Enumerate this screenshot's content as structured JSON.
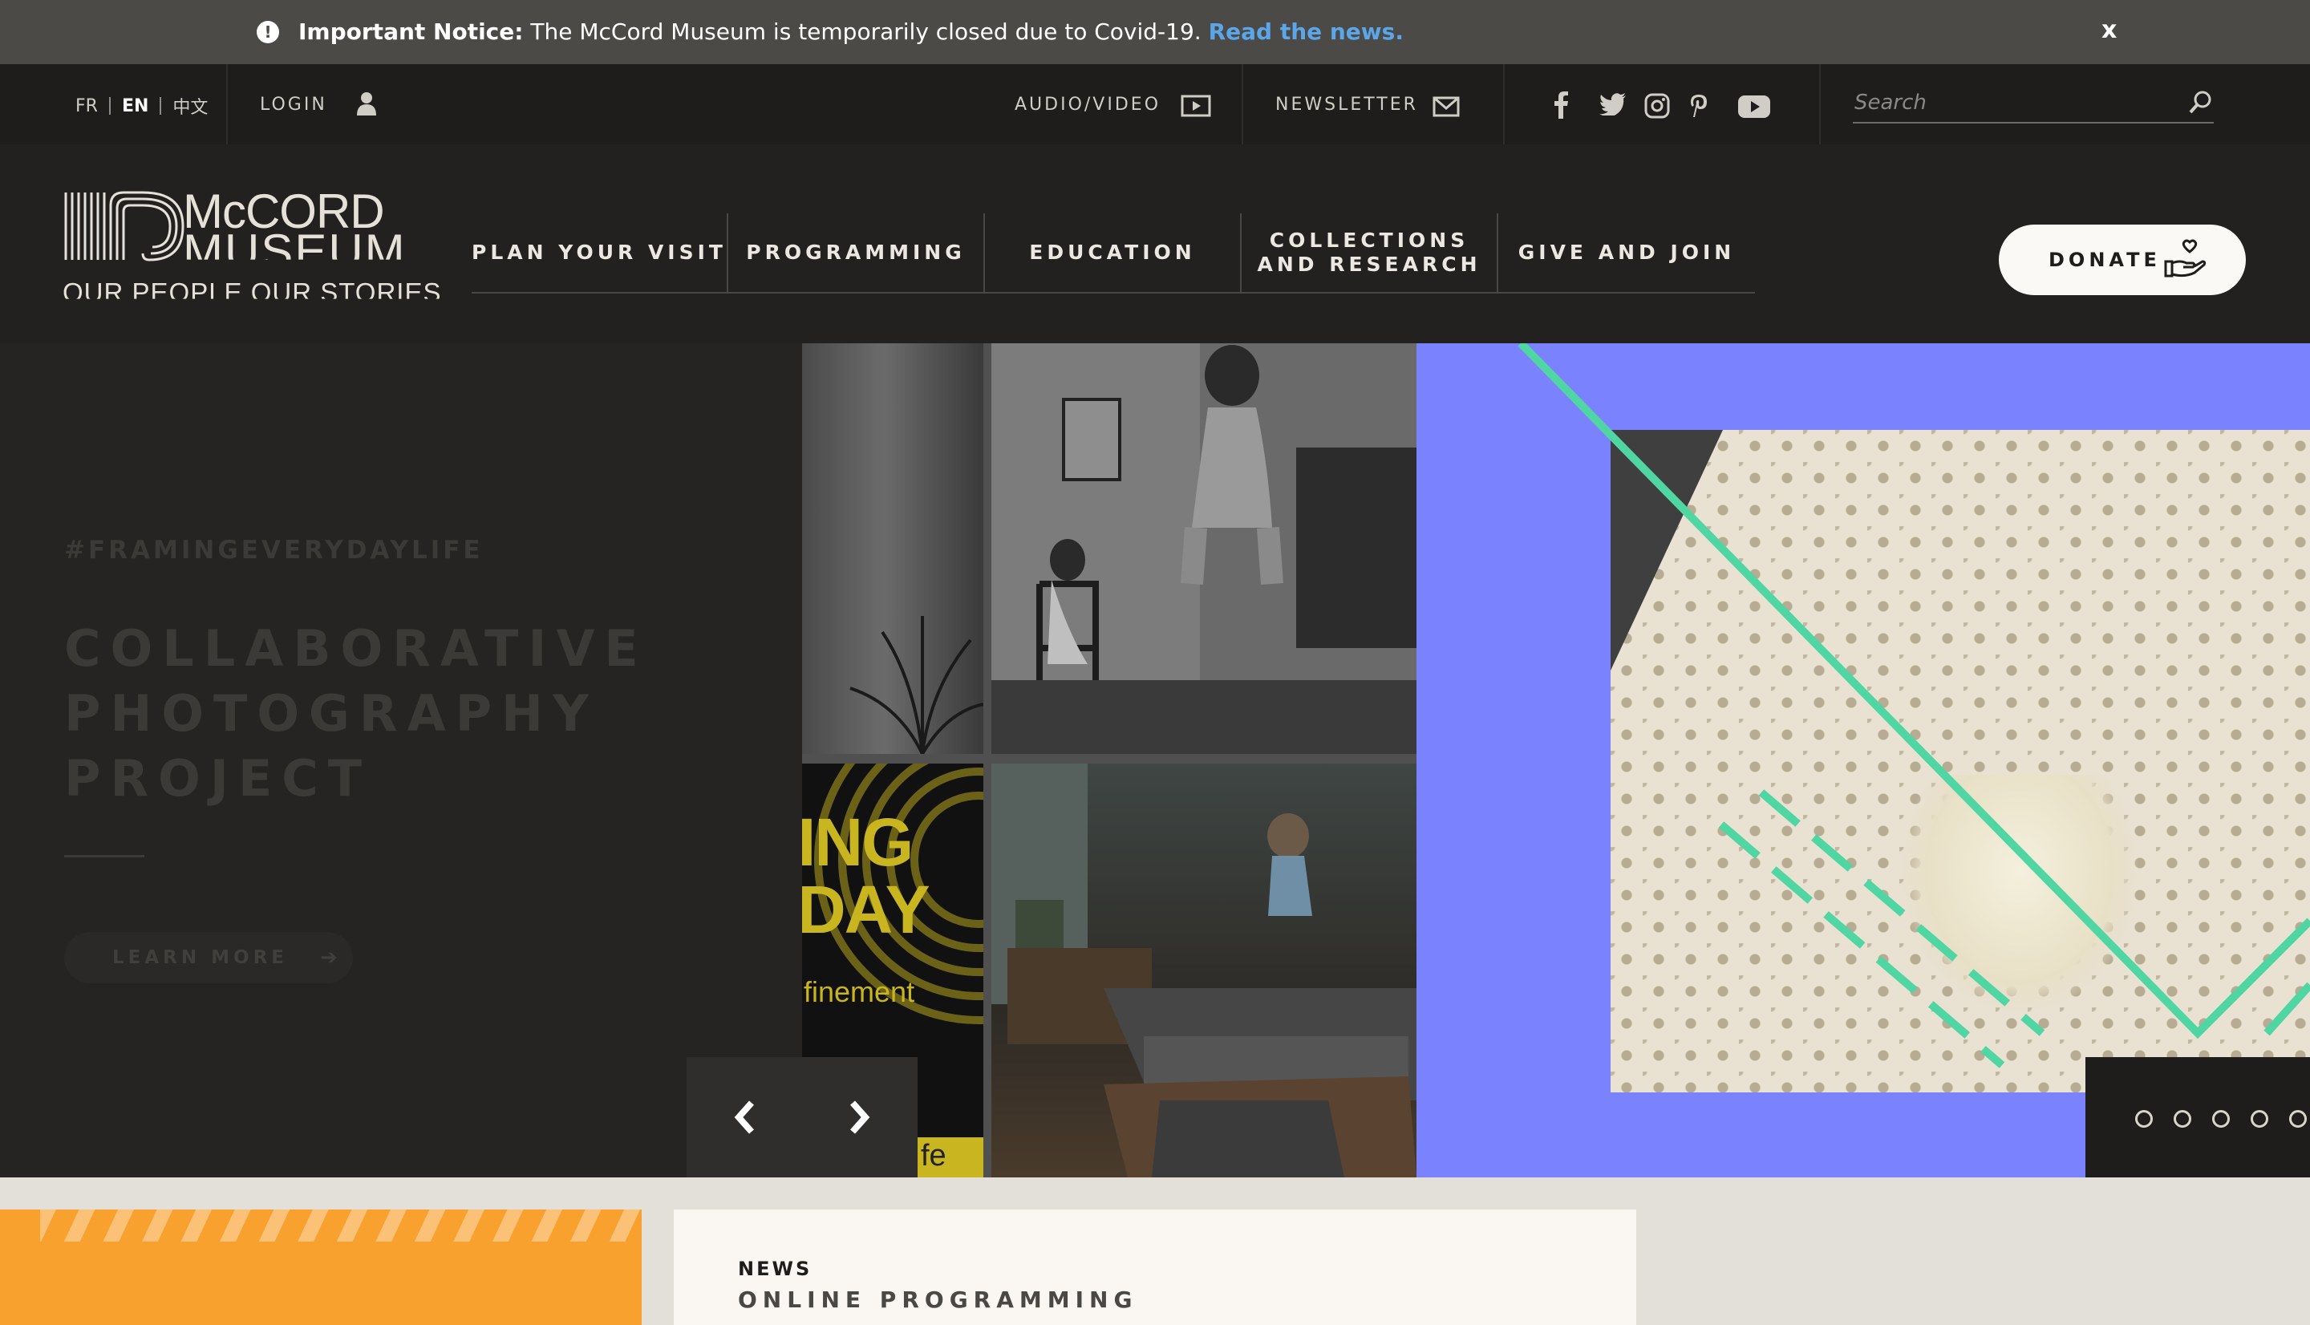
{
  "notice": {
    "label": "Important Notice:",
    "message": "The McCord Museum is temporarily closed due to Covid-19.",
    "link": "Read the news.",
    "close": "x"
  },
  "utility": {
    "languages": [
      "FR",
      "EN",
      "中文"
    ],
    "active_language": "EN",
    "login": "LOGIN",
    "audio_video": "AUDIO/VIDEO",
    "newsletter": "NEWSLETTER",
    "social": [
      "facebook-icon",
      "twitter-icon",
      "instagram-icon",
      "pinterest-icon",
      "youtube-icon"
    ],
    "search_placeholder": "Search"
  },
  "brand": {
    "line1": "McCORD",
    "line2": "MUSEUM",
    "tagline": "OUR PEOPLE OUR STORIES"
  },
  "nav": {
    "items": [
      "PLAN YOUR VISIT",
      "PROGRAMMING",
      "EDUCATION",
      "COLLECTIONS AND RESEARCH",
      "GIVE AND JOIN"
    ],
    "donate": "DONATE"
  },
  "hero": {
    "tag": "#FRAMINGEVERYDAYLIFE",
    "title": "COLLABORATIVE PHOTOGRAPHY PROJECT",
    "button": "LEARN MORE",
    "image_text": [
      "ING",
      "DAY",
      "finement",
      "fe"
    ],
    "slide_count": 5
  },
  "news": {
    "kicker": "NEWS",
    "title": "ONLINE PROGRAMMING"
  },
  "colors": {
    "accent_link": "#5aa6e8",
    "purple": "#7b82fd",
    "orange": "#f9a12e",
    "green_line": "#4fd6a2"
  }
}
